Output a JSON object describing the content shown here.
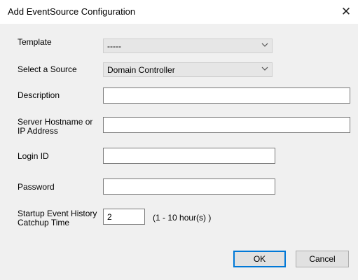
{
  "window": {
    "title": "Add EventSource Configuration",
    "close_glyph": "✕"
  },
  "form": {
    "template": {
      "label": "Template",
      "value": "-----"
    },
    "source": {
      "label": "Select a Source",
      "value": "Domain Controller"
    },
    "description": {
      "label": "Description",
      "value": ""
    },
    "server": {
      "label_line1": "Server Hostname or",
      "label_line2": "IP Address",
      "value": ""
    },
    "login": {
      "label": "Login ID",
      "value": ""
    },
    "password": {
      "label": "Password",
      "value": ""
    },
    "startup": {
      "label_line1": "Startup Event History",
      "label_line2": "Catchup Time",
      "value": "2",
      "hint": "(1 - 10 hour(s) )"
    }
  },
  "buttons": {
    "ok": "OK",
    "cancel": "Cancel"
  },
  "colors": {
    "background": "#f0f0f0",
    "combo_fill": "#e6e6e6",
    "focus_border": "#0078d7"
  }
}
